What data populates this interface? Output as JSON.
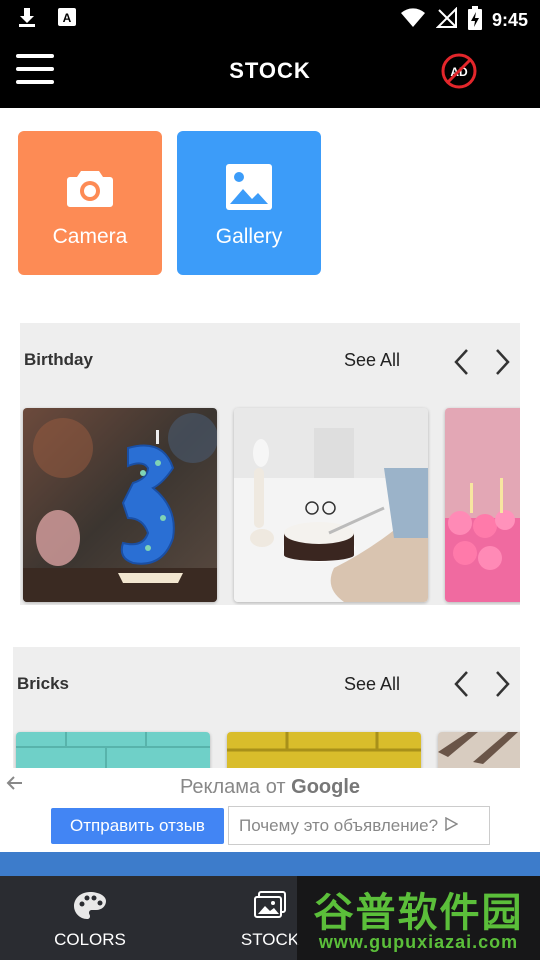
{
  "status_bar": {
    "time": "9:45",
    "icons": [
      "download-icon",
      "text-a-icon",
      "wifi-icon",
      "no-signal-icon",
      "battery-charging-icon"
    ]
  },
  "app_bar": {
    "title": "STOCK",
    "menu_icon": "hamburger-menu-icon",
    "noad_label": "AD"
  },
  "sources": [
    {
      "label": "Camera",
      "icon": "camera-icon",
      "color": "#fd8b55"
    },
    {
      "label": "Gallery",
      "icon": "image-icon",
      "color": "#3c9cf9"
    }
  ],
  "sections": [
    {
      "title": "Birthday",
      "see_all": "See All"
    },
    {
      "title": "Bricks",
      "see_all": "See All"
    }
  ],
  "ad": {
    "title_prefix": "Реклама от",
    "title_brand": "Google",
    "feedback_button": "Отправить отзыв",
    "why_button": "Почему это объявление?"
  },
  "bottom_nav": [
    {
      "label": "COLORS",
      "icon": "palette-icon"
    },
    {
      "label": "STOCK",
      "icon": "stock-images-icon"
    }
  ],
  "watermark": {
    "cn_text": "谷普软件园",
    "url": "www.gupuxiazai.com"
  },
  "colors": {
    "bar_bg": "#000000",
    "camera": "#fd8b55",
    "gallery": "#3c9cf9",
    "section_bg": "#eeeeee",
    "nav_bg": "#2a2c31",
    "ad_button": "#4285f4"
  }
}
